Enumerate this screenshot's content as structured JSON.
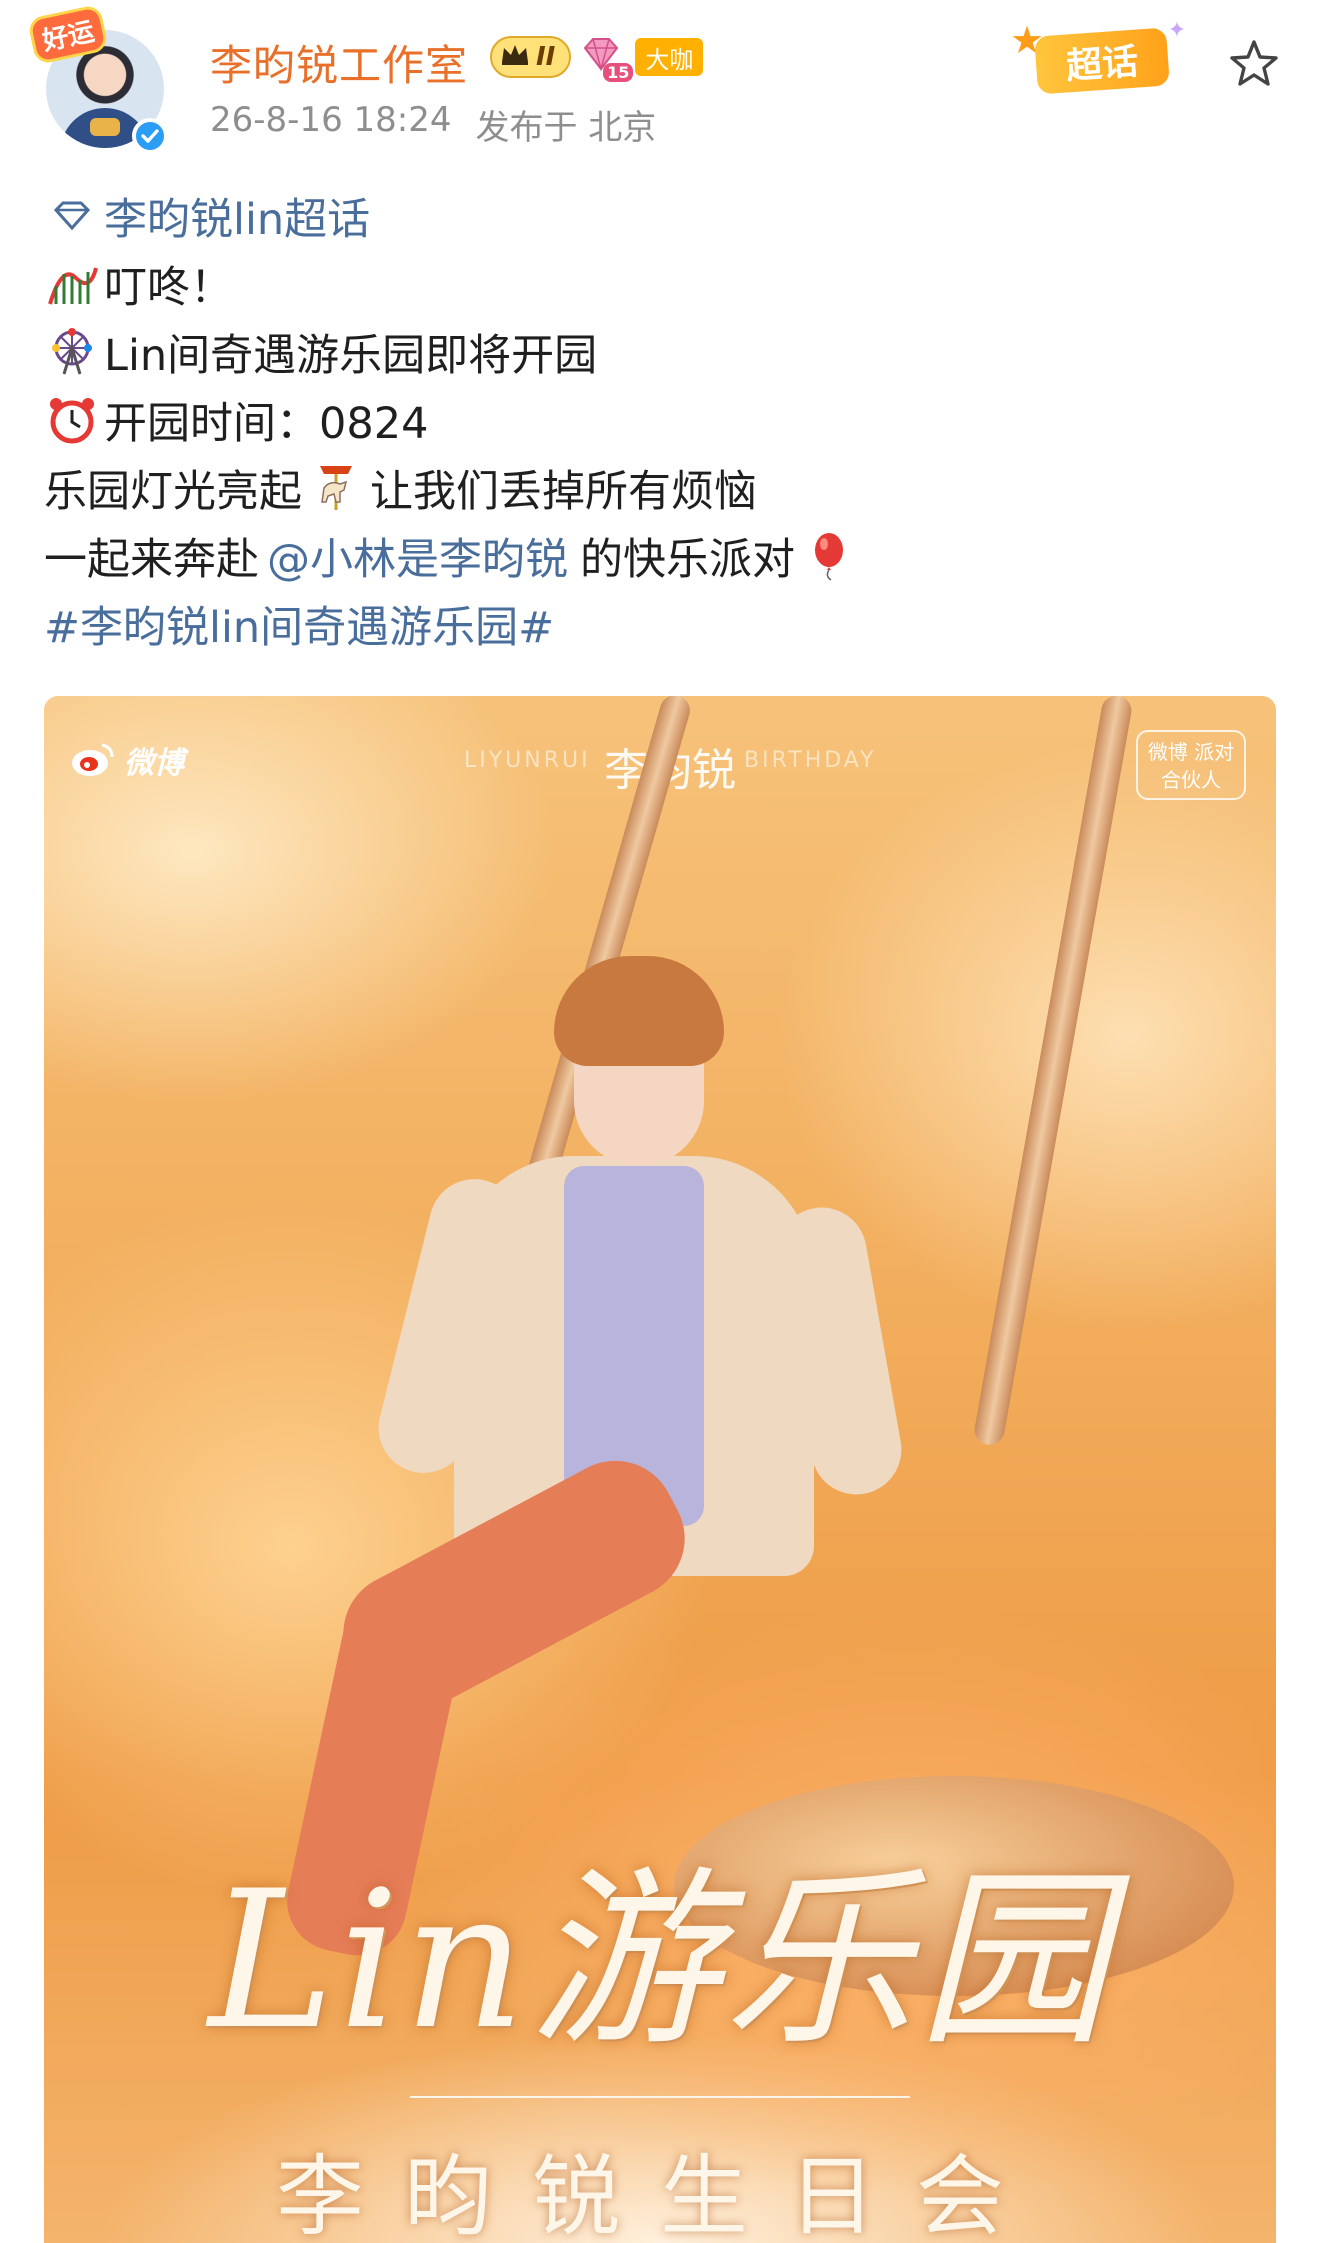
{
  "header": {
    "lucky_label": "好运",
    "username": "李昀锐工作室",
    "crown_level": "II",
    "gem_level": "15",
    "vip_label": "大咖",
    "date": "26-8-16 18:24",
    "location": "发布于 北京",
    "supertopic_button": "超话"
  },
  "post": {
    "topic_link": "李昀锐lin超话",
    "lines": [
      "叮咚！",
      "Lin间奇遇游乐园即将开园",
      "开园时间：0824"
    ],
    "line4_a": "乐园灯光亮起",
    "line4_b": "让我们丢掉所有烦恼",
    "line5_a": "一起来奔赴",
    "mention": "@小林是李昀锐",
    "line5_b": "的快乐派对",
    "hashtag": "#李昀锐lin间奇遇游乐园#",
    "emojis": [
      "roller-coaster",
      "ferris-wheel",
      "alarm-clock",
      "carousel-horse",
      "balloon"
    ]
  },
  "poster": {
    "weibo_text": "微博",
    "name_en_left": "LIYUNRUI",
    "name_cn": "李昀锐",
    "name_en_right": "BIRTHDAY",
    "partner_logo": "微博 派对合伙人",
    "title": "Lin游乐园",
    "subtitle": "李昀锐生日会"
  },
  "colors": {
    "username": "#e8702a",
    "link": "#4a6e9c",
    "meta": "#8e8e8e",
    "supertopic": "#ffa21a"
  }
}
